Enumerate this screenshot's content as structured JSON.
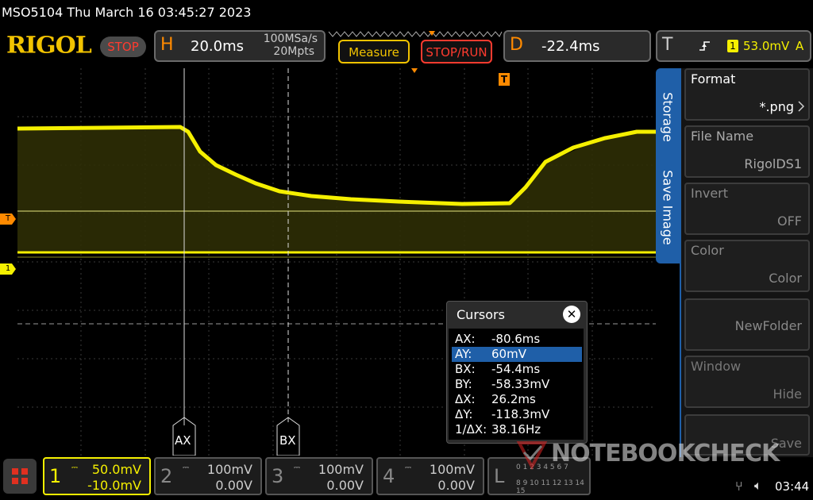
{
  "title_bar": {
    "text": "MSO5104  Thu March 16 03:45:27 2023"
  },
  "brand": {
    "logo": "RIGOL",
    "run_state": "STOP"
  },
  "horizontal": {
    "letter": "H",
    "timebase": "20.0ms",
    "sample_rate": "100MSa/s",
    "memory_depth": "20Mpts"
  },
  "buttons": {
    "measure": "Measure",
    "stop_run": "STOP/RUN"
  },
  "delay": {
    "letter": "D",
    "value": "-22.4ms"
  },
  "trigger": {
    "letter": "T",
    "source": "1",
    "level": "53.0mV",
    "mode": "A"
  },
  "markers": {
    "trigger_marker": "T",
    "channel1_marker": "1",
    "cursor_a_label": "AX",
    "cursor_b_label": "BX"
  },
  "side_tabs": {
    "storage": "Storage",
    "save_image": "Save Image"
  },
  "side_menu": [
    {
      "label": "Format",
      "value": "*.png"
    },
    {
      "label": "File Name",
      "value": "RigolDS1"
    },
    {
      "label": "Invert",
      "value": "OFF"
    },
    {
      "label": "Color",
      "value": "Color"
    },
    {
      "label": "",
      "value": "NewFolder"
    },
    {
      "label": "Window",
      "value": "Hide"
    },
    {
      "label": "",
      "value": "Save"
    }
  ],
  "cursors": {
    "title": "Cursors",
    "rows": [
      {
        "key": "AX:",
        "value": "-80.6ms"
      },
      {
        "key": "AY:",
        "value": "60mV"
      },
      {
        "key": "BX:",
        "value": "-54.4ms"
      },
      {
        "key": "BY:",
        "value": "-58.33mV"
      },
      {
        "key": "ΔX:",
        "value": "26.2ms"
      },
      {
        "key": "ΔY:",
        "value": "-118.3mV"
      },
      {
        "key": "1/ΔX:",
        "value": "38.16Hz"
      }
    ]
  },
  "channels": [
    {
      "num": "1",
      "scale": "50.0mV",
      "offset": "-10.0mV"
    },
    {
      "num": "2",
      "scale": "100mV",
      "offset": "0.00V"
    },
    {
      "num": "3",
      "scale": "100mV",
      "offset": "0.00V"
    },
    {
      "num": "4",
      "scale": "100mV",
      "offset": "0.00V"
    }
  ],
  "logic": {
    "letter": "L",
    "digits_top": "0 1 2 3 4 5 6 7",
    "digits_bottom": "8 9 10 11 12 13 14 15"
  },
  "watermark": "NOTEBOOKCHECK",
  "status": {
    "time": "03:44"
  },
  "colors": {
    "ch1": "#f5f000",
    "accent_orange": "#ff8a00",
    "stop_red": "#ff3b2f",
    "highlight_blue": "#1f5fa8"
  }
}
